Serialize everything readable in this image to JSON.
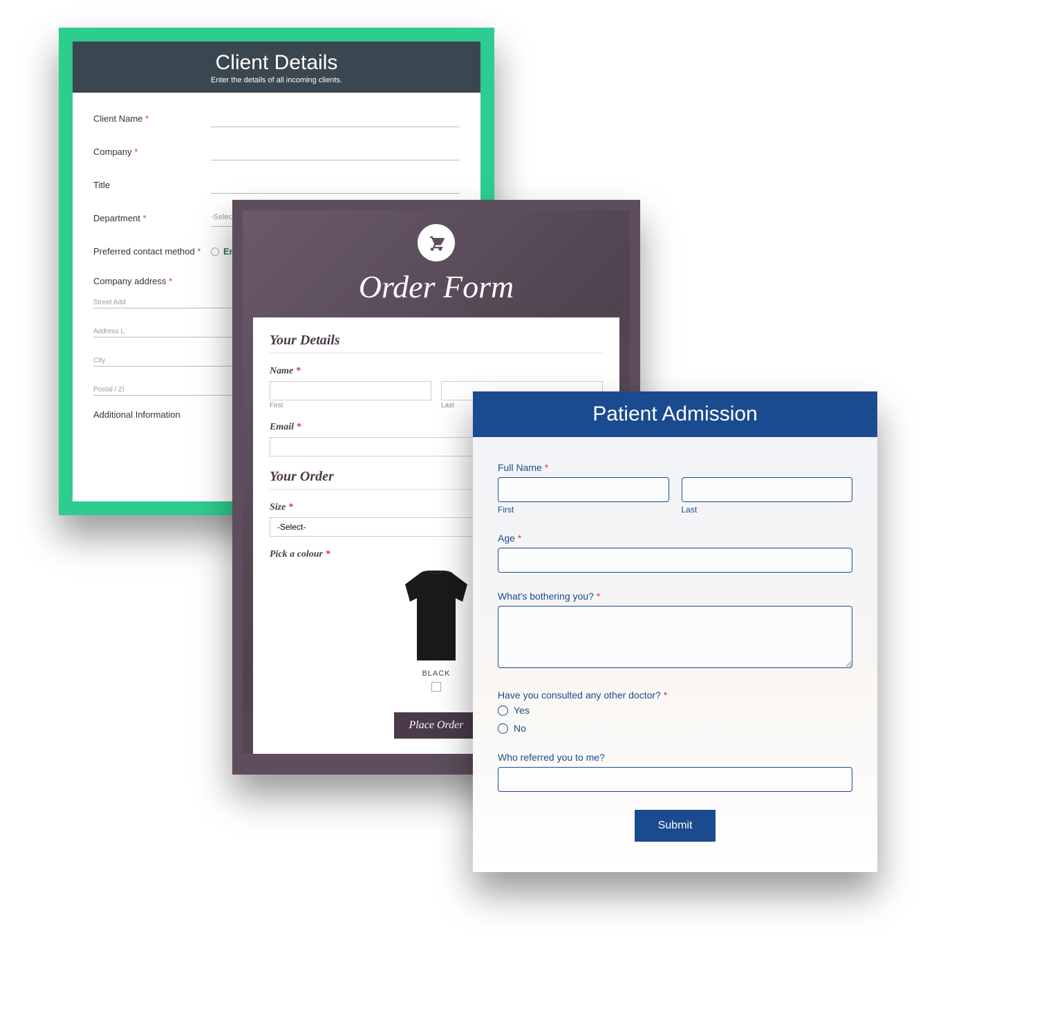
{
  "form1": {
    "title": "Client Details",
    "subtitle": "Enter the details of all incoming clients.",
    "labels": {
      "client_name": "Client Name",
      "company": "Company",
      "title": "Title",
      "department": "Department",
      "contact_method": "Preferred contact method",
      "company_address": "Company address",
      "additional_info": "Additional Information"
    },
    "select_placeholder": "-Select-",
    "radio_email": "Email",
    "address_placeholders": {
      "street": "Street Add",
      "line2": "Address L",
      "city": "City",
      "postal": "Postal / Zi"
    },
    "required": "*"
  },
  "form2": {
    "title": "Order Form",
    "sections": {
      "details": "Your Details",
      "order": "Your Order"
    },
    "labels": {
      "name": "Name",
      "first": "First",
      "last": "Last",
      "email": "Email",
      "size": "Size",
      "pick_colour": "Pick a colour"
    },
    "select_placeholder": "-Select-",
    "product_label": "BLACK",
    "submit": "Place Order",
    "required": "*"
  },
  "form3": {
    "title": "Patient Admission",
    "labels": {
      "full_name": "Full Name",
      "first": "First",
      "last": "Last",
      "age": "Age",
      "bothering": "What's bothering you?",
      "consulted": "Have you consulted any other doctor?",
      "yes": "Yes",
      "no": "No",
      "referred": "Who referred you to me?"
    },
    "submit": "Submit",
    "required": "*"
  }
}
